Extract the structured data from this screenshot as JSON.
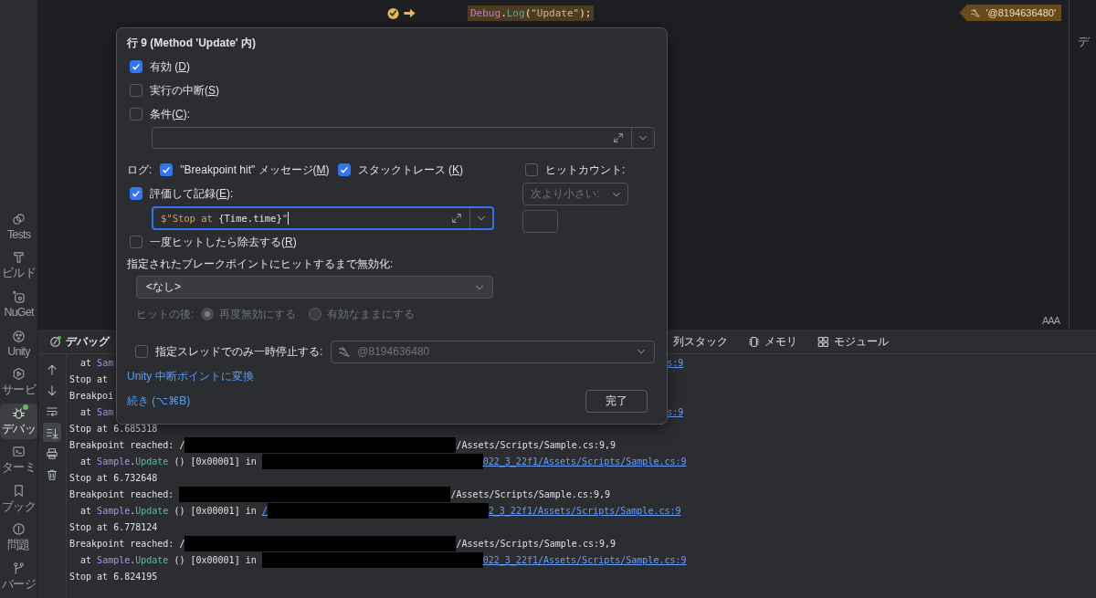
{
  "activity_bar": {
    "items": [
      {
        "label": "Tests",
        "selected": false
      },
      {
        "label": "ビルド",
        "selected": false
      },
      {
        "label": "NuGet",
        "selected": false
      },
      {
        "label": "Unity",
        "selected": false
      },
      {
        "label": "サービ",
        "selected": false
      },
      {
        "label": "デバッ",
        "selected": true
      },
      {
        "label": "ターミ",
        "selected": false
      },
      {
        "label": "ブック",
        "selected": false
      },
      {
        "label": "問題",
        "selected": false
      },
      {
        "label": "バージ",
        "selected": false
      }
    ]
  },
  "editor": {
    "line": {
      "code": [
        {
          "text": "Debug",
          "kind": "type"
        },
        {
          "text": ".",
          "kind": "plain"
        },
        {
          "text": "Log",
          "kind": "method"
        },
        {
          "text": "(",
          "kind": "plain"
        },
        {
          "text": "\"Update\"",
          "kind": "string"
        },
        {
          "text": ");",
          "kind": "plain"
        }
      ],
      "inline_hint": "'@8194636480'"
    },
    "reader_mode": "AAA",
    "side_label": "デ"
  },
  "popup": {
    "title": "行 9 (Method 'Update' 内)",
    "options": [
      {
        "checked": true,
        "label_parts": [
          "有効 (",
          "D",
          ")"
        ]
      },
      {
        "checked": false,
        "label_parts": [
          "実行の中断(",
          "S",
          ")"
        ]
      },
      {
        "checked": false,
        "label_parts": [
          "条件(",
          "C",
          "):"
        ]
      }
    ],
    "log": {
      "label": "ログ:",
      "message": {
        "checked": true,
        "label_parts": [
          "\"Breakpoint hit\" メッセージ(",
          "M",
          ")"
        ]
      },
      "stack_trace": {
        "checked": true,
        "label_parts": [
          "スタックトレース (",
          "K",
          ")"
        ]
      }
    },
    "evaluate": {
      "checked": true,
      "label_parts": [
        "評価して記録(",
        "E",
        "):"
      ]
    },
    "expression": [
      {
        "text": "$\"Stop at ",
        "kind": "string"
      },
      {
        "text": "{Time.time}",
        "kind": "interp"
      },
      {
        "text": "\"",
        "kind": "string"
      }
    ],
    "remove_once": {
      "checked": false,
      "label_parts": [
        "一度ヒットしたら除去する(",
        "R",
        ")"
      ]
    },
    "hit_count": {
      "checked": false,
      "label_parts": [
        "ヒットカウント:"
      ]
    },
    "hit_count_operator": {
      "value": "次より小さい:",
      "disabled": true
    },
    "disable_until_label": "指定されたブレークポイントにヒットするまで無効化:",
    "disable_until": {
      "value": "<なし>"
    },
    "after_hit": {
      "label": "ヒットの後:",
      "disabled": true,
      "options": [
        {
          "label": "再度無効にする",
          "selected": true
        },
        {
          "label": "有効なままにする",
          "selected": false
        }
      ]
    },
    "thread_only": {
      "checked": false,
      "label_parts": [
        "指定スレッドでのみ一時停止する:"
      ]
    },
    "thread": {
      "value": "@8194636480",
      "disabled": true
    },
    "convert_link": "Unity 中断ポイントに変換",
    "continue_link": "続き (⌥⌘B)",
    "done_button": "完了"
  },
  "debug_panel": {
    "title": "デバッグ",
    "tabs": [
      {
        "label": "列スタック"
      },
      {
        "label": "メモリ"
      },
      {
        "label": "モジュール"
      }
    ],
    "toolbar": [
      {
        "on": false
      },
      {
        "on": false
      },
      {
        "on": false
      },
      {
        "on": true
      },
      {
        "on": false
      },
      {
        "on": false
      }
    ],
    "lines": [
      {
        "kind": "covered",
        "segments": [
          {
            "text": "  at ",
            "kind": "plain"
          },
          {
            "text": "Sam",
            "kind": "type"
          },
          {
            "kind": "covered"
          },
          {
            "text": "s:9",
            "kind": "link"
          }
        ]
      },
      {
        "kind": "covered",
        "segments": [
          {
            "text": "Stop at",
            "kind": "plain"
          }
        ]
      },
      {
        "kind": "covered",
        "segments": [
          {
            "text": "Breakpoi",
            "kind": "plain"
          }
        ]
      },
      {
        "kind": "covered",
        "segments": [
          {
            "text": "  at ",
            "kind": "plain"
          },
          {
            "text": "Sam",
            "kind": "type"
          },
          {
            "kind": "covered"
          },
          {
            "text": "s:9",
            "kind": "link"
          }
        ]
      },
      {
        "kind": "stop",
        "segments": [
          {
            "text": "Stop at 6.685318",
            "kind": "plain"
          }
        ]
      },
      {
        "kind": "reached",
        "segments": [
          {
            "text": "Breakpoint reached: /",
            "kind": "plain"
          },
          {
            "kind": "redacted"
          },
          {
            "text": "/Assets/Scripts/Sample.cs:9,9",
            "kind": "plain"
          }
        ]
      },
      {
        "kind": "at",
        "segments": [
          {
            "text": "  at ",
            "kind": "plain"
          },
          {
            "text": "Sample",
            "kind": "type"
          },
          {
            "text": ".",
            "kind": "plain"
          },
          {
            "text": "Update",
            "kind": "method"
          },
          {
            "text": " () [0x00001] in ",
            "kind": "plain"
          },
          {
            "kind": "redacted"
          },
          {
            "text": "022_3_22f1/Assets/Scripts/Sample.cs:9",
            "kind": "link"
          }
        ]
      },
      {
        "kind": "stop",
        "segments": [
          {
            "text": "Stop at 6.732648",
            "kind": "plain"
          }
        ]
      },
      {
        "kind": "reached",
        "segments": [
          {
            "text": "Breakpoint reached: ",
            "kind": "plain"
          },
          {
            "kind": "redacted"
          },
          {
            "text": "/Assets/Scripts/Sample.cs:9,9",
            "kind": "plain"
          }
        ]
      },
      {
        "kind": "at",
        "segments": [
          {
            "text": "  at ",
            "kind": "plain"
          },
          {
            "text": "Sample",
            "kind": "type"
          },
          {
            "text": ".",
            "kind": "plain"
          },
          {
            "text": "Update",
            "kind": "method"
          },
          {
            "text": " () [0x00001] in ",
            "kind": "plain"
          },
          {
            "text": "/",
            "kind": "link"
          },
          {
            "kind": "redacted"
          },
          {
            "text": "2_3_22f1/Assets/Scripts/Sample.cs:9",
            "kind": "link"
          }
        ]
      },
      {
        "kind": "stop",
        "segments": [
          {
            "text": "Stop at 6.778124",
            "kind": "plain"
          }
        ]
      },
      {
        "kind": "reached",
        "segments": [
          {
            "text": "Breakpoint reached: /",
            "kind": "plain"
          },
          {
            "kind": "redacted"
          },
          {
            "text": "/Assets/Scripts/Sample.cs:9,9",
            "kind": "plain"
          }
        ]
      },
      {
        "kind": "at",
        "segments": [
          {
            "text": "  at ",
            "kind": "plain"
          },
          {
            "text": "Sample",
            "kind": "type"
          },
          {
            "text": ".",
            "kind": "plain"
          },
          {
            "text": "Update",
            "kind": "method"
          },
          {
            "text": " () [0x00001] in ",
            "kind": "plain"
          },
          {
            "kind": "redacted"
          },
          {
            "text": "022_3_22f1/Assets/Scripts/Sample.cs:9",
            "kind": "link"
          }
        ]
      },
      {
        "kind": "stop",
        "segments": [
          {
            "text": "Stop at 6.824195",
            "kind": "plain"
          }
        ]
      }
    ]
  }
}
